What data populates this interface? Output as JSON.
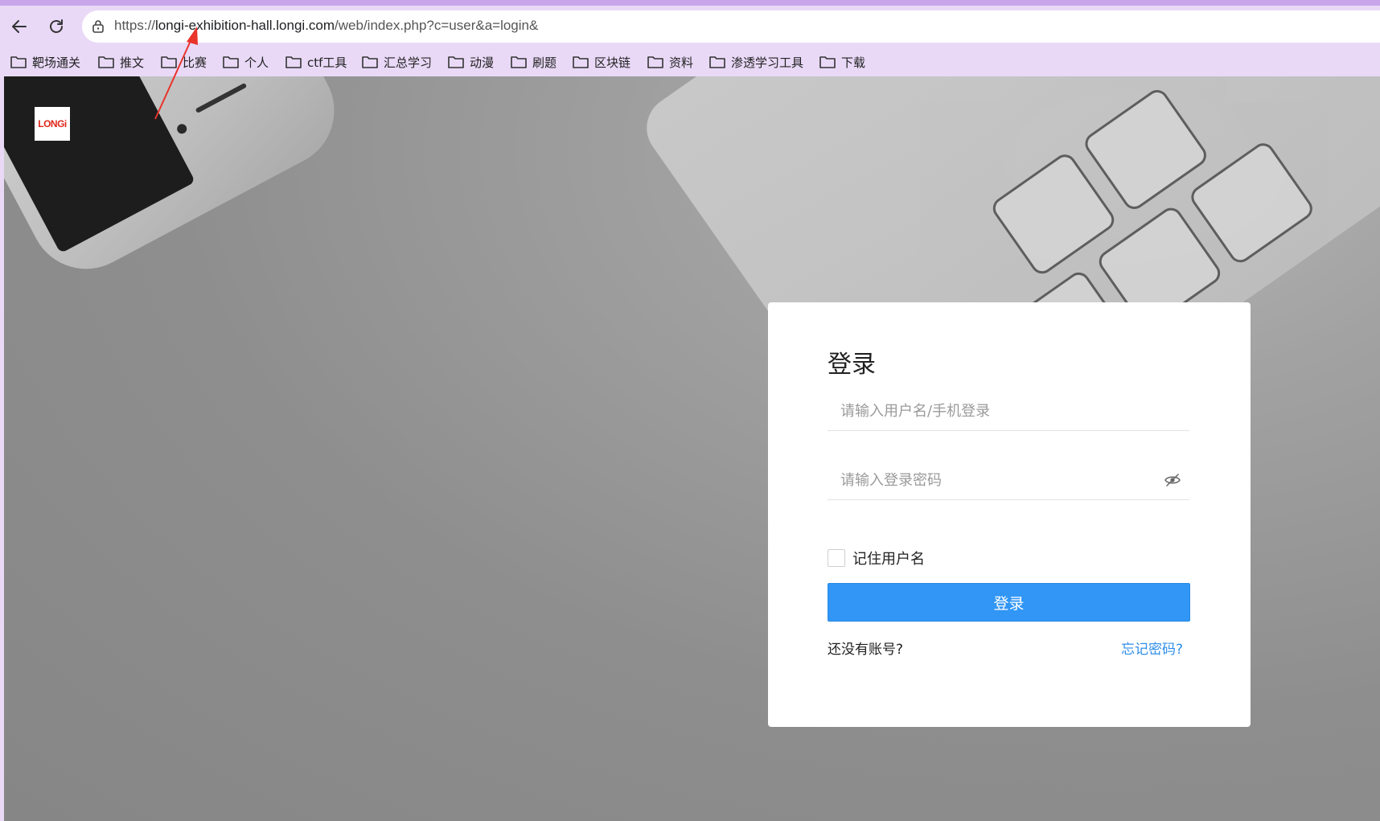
{
  "browser": {
    "url_prefix": "https://",
    "url_domain": "longi-exhibition-hall.longi.com",
    "url_path": "/web/index.php?c=user&a=login&"
  },
  "bookmarks": [
    {
      "label": "靶场通关"
    },
    {
      "label": "推文"
    },
    {
      "label": "比赛"
    },
    {
      "label": "个人"
    },
    {
      "label": "ctf工具"
    },
    {
      "label": "汇总学习"
    },
    {
      "label": "动漫"
    },
    {
      "label": "刷题"
    },
    {
      "label": "区块链"
    },
    {
      "label": "资料"
    },
    {
      "label": "渗透学习工具"
    },
    {
      "label": "下载"
    }
  ],
  "logo": {
    "text": "LONGi"
  },
  "login": {
    "title": "登录",
    "username_placeholder": "请输入用户名/手机登录",
    "password_placeholder": "请输入登录密码",
    "remember_label": "记住用户名",
    "submit_label": "登录",
    "no_account": "还没有账号?",
    "forgot_password": "忘记密码?"
  },
  "colors": {
    "browser_chrome": "#e9d9f7",
    "accent_button": "#3196f5",
    "link": "#2f8ee8",
    "annotation_arrow": "#e8342b"
  }
}
